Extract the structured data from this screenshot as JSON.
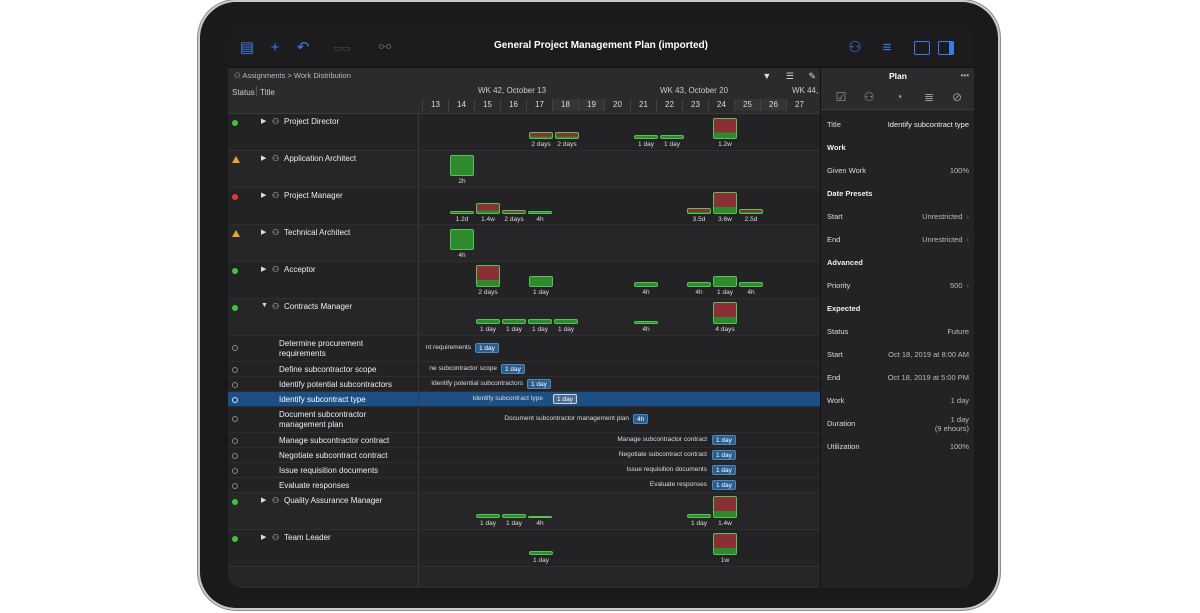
{
  "app": {
    "title": "General Project Management Plan (imported)",
    "breadcrumb_root": "Assignments",
    "breadcrumb_sep": ">",
    "breadcrumb_leaf": "Work Distribution",
    "toolbar_icons": [
      "document-icon",
      "plus-icon",
      "undo-icon",
      "baseline-icon",
      "link-icon"
    ],
    "toolbar_right_icons": [
      "person-icon",
      "list-icon",
      "sidebar-left-icon",
      "sidebar-right-icon"
    ]
  },
  "columns": {
    "status": "Status",
    "title": "Title"
  },
  "timeline": {
    "weeks": [
      {
        "label": "WK 42, October 13"
      },
      {
        "label": "WK 43, October 20"
      },
      {
        "label": "WK 44,"
      }
    ],
    "days": [
      "13",
      "14",
      "15",
      "16",
      "17",
      "18",
      "19",
      "20",
      "21",
      "22",
      "23",
      "24",
      "25",
      "26",
      "27"
    ]
  },
  "resources": [
    {
      "name": "Project Director",
      "status": "green",
      "expanded": false
    },
    {
      "name": "Application Architect",
      "status": "orange",
      "expanded": false
    },
    {
      "name": "Project Manager",
      "status": "red",
      "expanded": false
    },
    {
      "name": "Technical Architect",
      "status": "orange",
      "expanded": false
    },
    {
      "name": "Acceptor",
      "status": "green",
      "expanded": false
    },
    {
      "name": "Contracts Manager",
      "status": "green",
      "expanded": true
    },
    {
      "name": "Quality Assurance Manager",
      "status": "green",
      "expanded": false
    },
    {
      "name": "Team Leader",
      "status": "green",
      "expanded": false
    }
  ],
  "tasks": [
    {
      "name": "Determine procurement requirements",
      "gantt_label": "nt requirements",
      "duration": "1 day"
    },
    {
      "name": "Define subcontractor scope",
      "gantt_label": "ne subcontractor scope",
      "duration": "1 day"
    },
    {
      "name": "Identify potential subcontractors",
      "gantt_label": "Identify potential subcontractors",
      "duration": "1 day"
    },
    {
      "name": "Identify subcontract type",
      "gantt_label": "Identify subcontract type",
      "duration": "1 day"
    },
    {
      "name": "Document subcontractor management plan",
      "gantt_label": "Document subcontractor management plan",
      "duration": "4h"
    },
    {
      "name": "Manage subcontractor contract",
      "gantt_label": "Manage subcontractor contract",
      "duration": "1 day"
    },
    {
      "name": "Negotiate subcontract contract",
      "gantt_label": "Negotiate subcontract contract",
      "duration": "1 day"
    },
    {
      "name": "Issue requisition documents",
      "gantt_label": "Issue requisition documents",
      "duration": "1 day"
    },
    {
      "name": "Evaluate responses",
      "gantt_label": "Evaluate responses",
      "duration": "1 day"
    }
  ],
  "allocation_labels": {
    "project_director": [
      "2 days",
      "2 days",
      "1 day",
      "1 day",
      "1.2w"
    ],
    "application_architect": [
      "2h"
    ],
    "project_manager": [
      "1.2d",
      "1.4w",
      "2 days",
      "4h",
      "3.5d",
      "3.6w",
      "2.5d"
    ],
    "technical_architect": [
      "4h"
    ],
    "acceptor": [
      "2 days",
      "1 day",
      "4h",
      "4h",
      "1 day",
      "4h"
    ],
    "contracts_manager": [
      "1 day",
      "1 day",
      "1 day",
      "1 day",
      "4h",
      "4 days"
    ],
    "qa_manager": [
      "1 day",
      "1 day",
      "4h",
      "1 day",
      "1.4w"
    ],
    "team_leader": [
      "1 day",
      "1w"
    ]
  },
  "inspector": {
    "title": "Plan",
    "more": "•••",
    "tab_icons": [
      "checklist-icon",
      "resource-icon",
      "progress-icon",
      "lines-icon",
      "slash-icon"
    ],
    "title_label": "Title",
    "title_value": "Identify subcontract type",
    "work_section": "Work",
    "given_work_label": "Given Work",
    "given_work_value": "100%",
    "date_presets_section": "Date Presets",
    "start_label": "Start",
    "start_value": "Unrestricted",
    "end_label": "End",
    "end_value": "Unrestricted",
    "advanced_section": "Advanced",
    "priority_label": "Priority",
    "priority_value": "500",
    "expected_section": "Expected",
    "status_label": "Status",
    "status_value": "Future",
    "exp_start_label": "Start",
    "exp_start_value": "Oct 18, 2019 at 8:00 AM",
    "exp_end_label": "End",
    "exp_end_value": "Oct 18, 2019 at 5:00 PM",
    "exp_work_label": "Work",
    "exp_work_value": "1 day",
    "duration_label": "Duration",
    "duration_value": "1 day",
    "duration_sub": "(9 ehours)",
    "utilization_label": "Utilization",
    "utilization_value": "100%"
  }
}
